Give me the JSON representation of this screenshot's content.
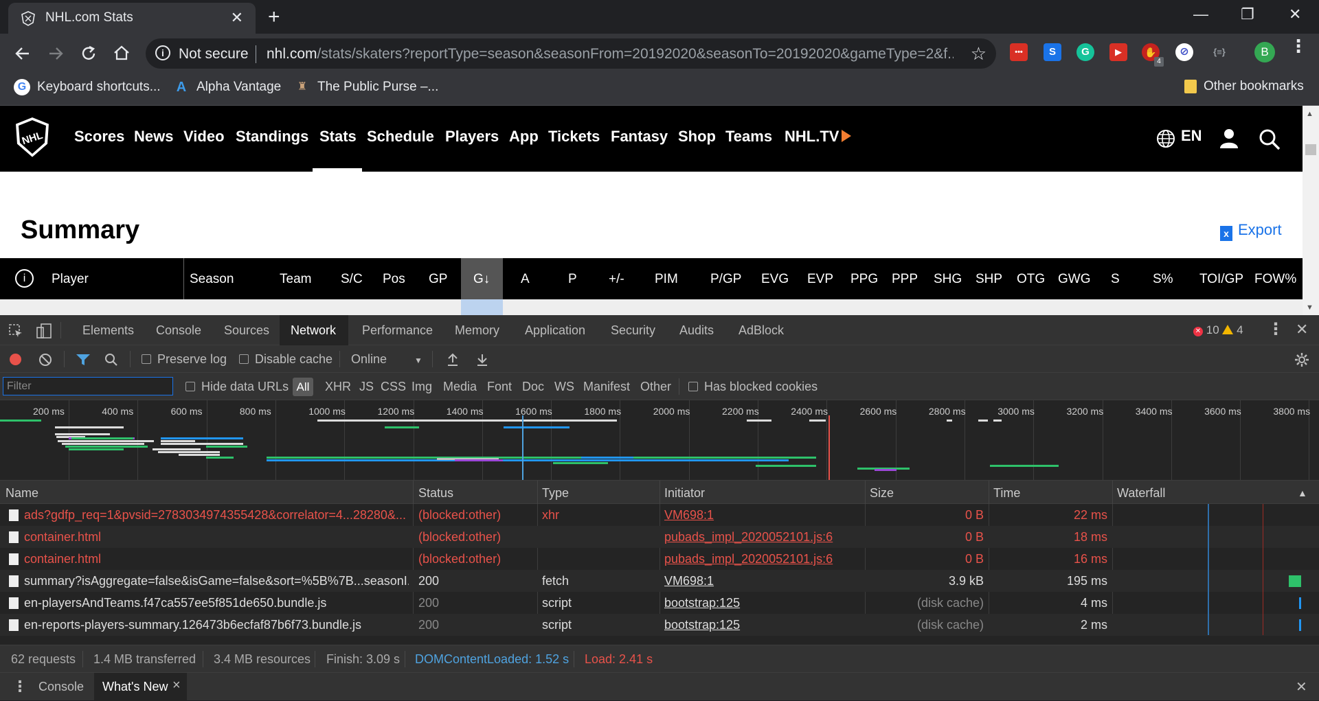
{
  "browser": {
    "tab_title": "NHL.com Stats",
    "tab_close": "✕",
    "new_tab": "+",
    "window_controls": [
      "—",
      "❐",
      "✕"
    ],
    "security_label": "Not secure",
    "url_host": "nhl.com",
    "url_rest": "/stats/skaters?reportType=season&seasonFrom=20192020&seasonTo=20192020&gameType=2&f...",
    "bookmarks": [
      {
        "label": "Keyboard shortcuts...",
        "icon": "google-icon"
      },
      {
        "label": "Alpha Vantage",
        "icon": "alpha-vantage-icon"
      },
      {
        "label": "The Public Purse –...",
        "icon": "public-purse-icon"
      },
      {
        "label": "Other bookmarks",
        "icon": "folder-icon"
      }
    ],
    "profile_initial": "B",
    "extension_badge": "4",
    "extension_icon_text": [
      "•••",
      "S",
      "G",
      "▶",
      "✋",
      "⊘",
      "{≡}"
    ]
  },
  "nhl": {
    "nav": [
      "Scores",
      "News",
      "Video",
      "Standings",
      "Stats",
      "Schedule",
      "Players",
      "App",
      "Tickets",
      "Fantasy",
      "Shop",
      "Teams",
      "NHL.TV"
    ],
    "logo_text": "NHL",
    "lang": "EN",
    "page_title": "Summary",
    "export_label": "Export",
    "export_icon_text": "x",
    "table_columns": [
      "Player",
      "Season",
      "Team",
      "S/C",
      "Pos",
      "GP",
      "G↓",
      "A",
      "P",
      "+/-",
      "PIM",
      "P/GP",
      "EVG",
      "EVP",
      "PPG",
      "PPP",
      "SHG",
      "SHP",
      "OTG",
      "GWG",
      "S",
      "S%",
      "TOI/GP",
      "FOW%"
    ],
    "info_icon_text": "i"
  },
  "devtools": {
    "tabs": [
      "Elements",
      "Console",
      "Sources",
      "Network",
      "Performance",
      "Memory",
      "Application",
      "Security",
      "Audits",
      "AdBlock"
    ],
    "error_count": "10",
    "warning_count": "4",
    "error_icon_text": "✕",
    "toolbar": {
      "preserve_log": "Preserve log",
      "disable_cache": "Disable cache",
      "throttle": "Online"
    },
    "filter_placeholder": "Filter",
    "hide_data_urls": "Hide data URLs",
    "filter_types": [
      "All",
      "XHR",
      "JS",
      "CSS",
      "Img",
      "Media",
      "Font",
      "Doc",
      "WS",
      "Manifest",
      "Other"
    ],
    "has_blocked_cookies": "Has blocked cookies",
    "overview_ticks": [
      "200 ms",
      "400 ms",
      "600 ms",
      "800 ms",
      "1000 ms",
      "1200 ms",
      "1400 ms",
      "1600 ms",
      "1800 ms",
      "2000 ms",
      "2200 ms",
      "2400 ms",
      "2600 ms",
      "2800 ms",
      "3000 ms",
      "3200 ms",
      "3400 ms",
      "3600 ms",
      "3800 ms"
    ],
    "columns": [
      "Name",
      "Status",
      "Type",
      "Initiator",
      "Size",
      "Time",
      "Waterfall"
    ],
    "sort_indicator": "▲",
    "requests": [
      {
        "name": "ads?gdfp_req=1&pvsid=2783034974355428&correlator=4...28280&...",
        "status": "(blocked:other)",
        "type": "xhr",
        "initiator": "VM698:1",
        "size": "0 B",
        "time": "22 ms",
        "state": "blocked"
      },
      {
        "name": "container.html",
        "status": "(blocked:other)",
        "type": "",
        "initiator": "pubads_impl_2020052101.js:6",
        "size": "0 B",
        "time": "18 ms",
        "state": "blocked"
      },
      {
        "name": "container.html",
        "status": "(blocked:other)",
        "type": "",
        "initiator": "pubads_impl_2020052101.js:6",
        "size": "0 B",
        "time": "16 ms",
        "state": "blocked"
      },
      {
        "name": "summary?isAggregate=false&isGame=false&sort=%5B%7B...seasonI...",
        "status": "200",
        "type": "fetch",
        "initiator": "VM698:1",
        "size": "3.9 kB",
        "time": "195 ms",
        "state": "ok"
      },
      {
        "name": "en-playersAndTeams.f47ca557ee5f851de650.bundle.js",
        "status": "200",
        "type": "script",
        "initiator": "bootstrap:125",
        "size": "(disk cache)",
        "time": "4 ms",
        "state": "cached"
      },
      {
        "name": "en-reports-players-summary.126473b6ecfaf87b6f73.bundle.js",
        "status": "200",
        "type": "script",
        "initiator": "bootstrap:125",
        "size": "(disk cache)",
        "time": "2 ms",
        "state": "cached"
      }
    ],
    "summary": {
      "requests": "62 requests",
      "transferred": "1.4 MB transferred",
      "resources": "3.4 MB resources",
      "finish": "Finish: 3.09 s",
      "dom_content_loaded": "DOMContentLoaded: 1.52 s",
      "load": "Load: 2.41 s"
    },
    "drawer_tabs": [
      "Console",
      "What's New"
    ],
    "drawer_tab_close": "×",
    "colors": {
      "dcl": "#4fa3e0",
      "load": "#e8524a",
      "blocked": "#e8524a"
    }
  }
}
